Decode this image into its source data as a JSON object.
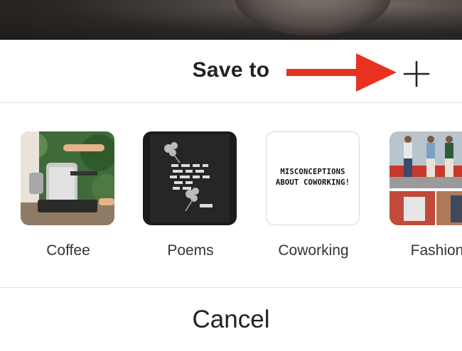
{
  "sheet": {
    "title": "Save to",
    "add_symbol": "+",
    "cancel_label": "Cancel"
  },
  "boards": [
    {
      "name": "Coffee"
    },
    {
      "name": "Poems"
    },
    {
      "name": "Coworking",
      "thumbnail_text": "MISCONCEPTIONS ABOUT COWORKING!"
    },
    {
      "name": "Fashion"
    }
  ],
  "colors": {
    "arrow": "#e8321f",
    "text": "#222222",
    "divider": "#e2e2e2"
  }
}
